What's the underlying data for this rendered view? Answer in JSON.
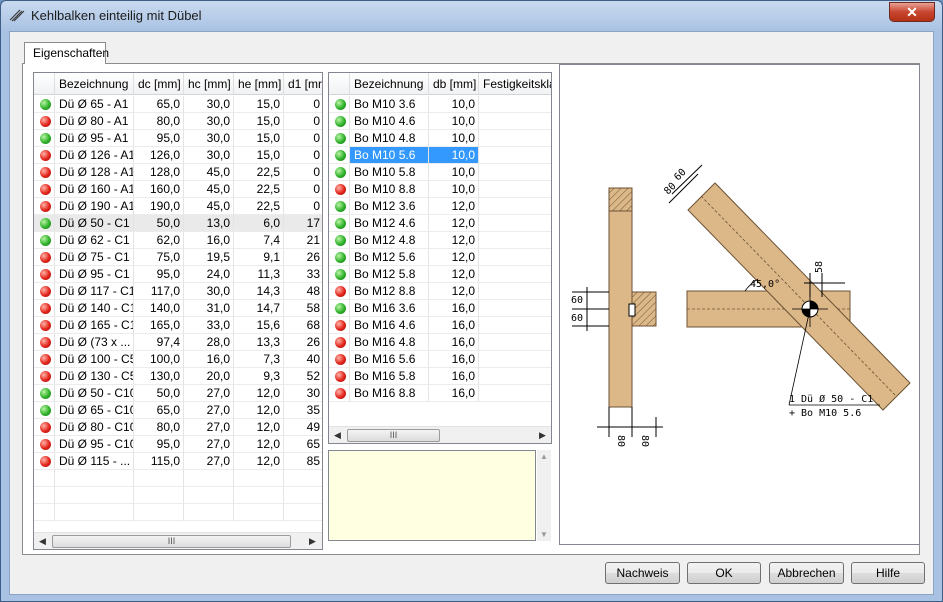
{
  "window": {
    "title": "Kehlbalken einteilig mit Dübel",
    "close_glyph": "✕"
  },
  "tabs": [
    {
      "label": "Eigenschaften"
    }
  ],
  "left_table": {
    "columns": [
      "Bezeichnung",
      "dc [mm]",
      "hc [mm]",
      "he [mm]",
      "d1 [mr"
    ],
    "rows": [
      {
        "status": "green",
        "name": "Dü Ø 65 - A1",
        "dc": "65,0",
        "hc": "30,0",
        "he": "15,0",
        "d1": "0"
      },
      {
        "status": "red",
        "name": "Dü Ø 80 - A1",
        "dc": "80,0",
        "hc": "30,0",
        "he": "15,0",
        "d1": "0"
      },
      {
        "status": "green",
        "name": "Dü Ø 95 - A1",
        "dc": "95,0",
        "hc": "30,0",
        "he": "15,0",
        "d1": "0"
      },
      {
        "status": "red",
        "name": "Dü Ø 126 - A1",
        "dc": "126,0",
        "hc": "30,0",
        "he": "15,0",
        "d1": "0"
      },
      {
        "status": "red",
        "name": "Dü Ø 128 - A1",
        "dc": "128,0",
        "hc": "45,0",
        "he": "22,5",
        "d1": "0"
      },
      {
        "status": "red",
        "name": "Dü Ø 160 - A1",
        "dc": "160,0",
        "hc": "45,0",
        "he": "22,5",
        "d1": "0"
      },
      {
        "status": "red",
        "name": "Dü Ø 190 - A1",
        "dc": "190,0",
        "hc": "45,0",
        "he": "22,5",
        "d1": "0"
      },
      {
        "status": "green",
        "name": "Dü Ø 50 - C1",
        "dc": "50,0",
        "hc": "13,0",
        "he": "6,0",
        "d1": "17"
      },
      {
        "status": "green",
        "name": "Dü Ø 62 - C1",
        "dc": "62,0",
        "hc": "16,0",
        "he": "7,4",
        "d1": "21"
      },
      {
        "status": "red",
        "name": "Dü Ø 75 - C1",
        "dc": "75,0",
        "hc": "19,5",
        "he": "9,1",
        "d1": "26"
      },
      {
        "status": "red",
        "name": "Dü Ø 95 - C1",
        "dc": "95,0",
        "hc": "24,0",
        "he": "11,3",
        "d1": "33"
      },
      {
        "status": "red",
        "name": "Dü Ø 117 - C1",
        "dc": "117,0",
        "hc": "30,0",
        "he": "14,3",
        "d1": "48"
      },
      {
        "status": "red",
        "name": "Dü Ø 140 - C1",
        "dc": "140,0",
        "hc": "31,0",
        "he": "14,7",
        "d1": "58"
      },
      {
        "status": "red",
        "name": "Dü Ø 165 - C1",
        "dc": "165,0",
        "hc": "33,0",
        "he": "15,6",
        "d1": "68"
      },
      {
        "status": "red",
        "name": "Dü Ø (73 x ...",
        "dc": "97,4",
        "hc": "28,0",
        "he": "13,3",
        "d1": "26"
      },
      {
        "status": "red",
        "name": "Dü Ø 100 - C5",
        "dc": "100,0",
        "hc": "16,0",
        "he": "7,3",
        "d1": "40"
      },
      {
        "status": "red",
        "name": "Dü Ø 130 - C5",
        "dc": "130,0",
        "hc": "20,0",
        "he": "9,3",
        "d1": "52"
      },
      {
        "status": "green",
        "name": "Dü Ø 50 - C10",
        "dc": "50,0",
        "hc": "27,0",
        "he": "12,0",
        "d1": "30"
      },
      {
        "status": "green",
        "name": "Dü Ø 65 - C10",
        "dc": "65,0",
        "hc": "27,0",
        "he": "12,0",
        "d1": "35"
      },
      {
        "status": "red",
        "name": "Dü Ø 80 - C10",
        "dc": "80,0",
        "hc": "27,0",
        "he": "12,0",
        "d1": "49"
      },
      {
        "status": "red",
        "name": "Dü Ø 95 - C10",
        "dc": "95,0",
        "hc": "27,0",
        "he": "12,0",
        "d1": "65"
      },
      {
        "status": "red",
        "name": "Dü Ø 115 - ...",
        "dc": "115,0",
        "hc": "27,0",
        "he": "12,0",
        "d1": "85"
      }
    ],
    "hover_row": 7,
    "scroll_thumb": "III"
  },
  "right_table": {
    "columns": [
      "Bezeichnung",
      "db [mm]",
      "Festigkeitsklas"
    ],
    "rows": [
      {
        "status": "green",
        "name": "Bo M10 3.6",
        "db": "10,0"
      },
      {
        "status": "green",
        "name": "Bo M10 4.6",
        "db": "10,0"
      },
      {
        "status": "green",
        "name": "Bo M10 4.8",
        "db": "10,0"
      },
      {
        "status": "green",
        "name": "Bo M10 5.6",
        "db": "10,0"
      },
      {
        "status": "green",
        "name": "Bo M10 5.8",
        "db": "10,0"
      },
      {
        "status": "red",
        "name": "Bo M10 8.8",
        "db": "10,0"
      },
      {
        "status": "green",
        "name": "Bo M12 3.6",
        "db": "12,0"
      },
      {
        "status": "green",
        "name": "Bo M12 4.6",
        "db": "12,0"
      },
      {
        "status": "green",
        "name": "Bo M12 4.8",
        "db": "12,0"
      },
      {
        "status": "green",
        "name": "Bo M12 5.6",
        "db": "12,0"
      },
      {
        "status": "green",
        "name": "Bo M12 5.8",
        "db": "12,0"
      },
      {
        "status": "red",
        "name": "Bo M12 8.8",
        "db": "12,0"
      },
      {
        "status": "green",
        "name": "Bo M16 3.6",
        "db": "16,0"
      },
      {
        "status": "red",
        "name": "Bo M16 4.6",
        "db": "16,0"
      },
      {
        "status": "red",
        "name": "Bo M16 4.8",
        "db": "16,0"
      },
      {
        "status": "red",
        "name": "Bo M16 5.6",
        "db": "16,0"
      },
      {
        "status": "red",
        "name": "Bo M16 5.8",
        "db": "16,0"
      },
      {
        "status": "red",
        "name": "Bo M16 8.8",
        "db": "16,0"
      }
    ],
    "selected_row": 3,
    "scroll_thumb": "III"
  },
  "drawing": {
    "dim_top_1": "60",
    "dim_top_2": "80",
    "dim_left_1": "60",
    "dim_left_2": "60",
    "dim_right": "58",
    "dim_bottom_1": "80",
    "dim_bottom_2": "80",
    "angle": "45,0°",
    "label_line1": "1 Dü Ø 50 - C1",
    "label_line2": "+ Bo M10 5.6"
  },
  "buttons": {
    "check": "Nachweis",
    "ok": "OK",
    "cancel": "Abbrechen",
    "help": "Hilfe"
  },
  "colors": {
    "wood": "#dcb888",
    "wood_edge": "#6b5234",
    "selection": "#3399ff",
    "note_bg": "#ffffe1"
  }
}
